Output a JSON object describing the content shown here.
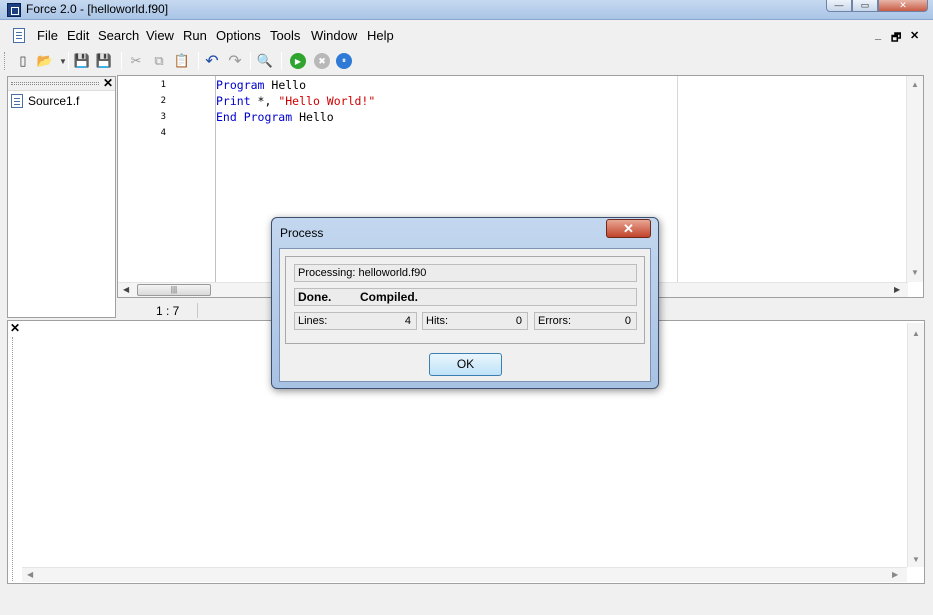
{
  "window": {
    "title": "Force 2.0 - [helloworld.f90]",
    "minimize": "—",
    "maximize": "▭",
    "close": "✕"
  },
  "menu": {
    "items": [
      "File",
      "Edit",
      "Search",
      "View",
      "Run",
      "Options",
      "Tools",
      "Window",
      "Help"
    ]
  },
  "mdi_controls": {
    "minimize": "_",
    "restore": "🗗",
    "close": "✕"
  },
  "toolbar": {
    "buttons": [
      {
        "name": "new-icon",
        "glyph": "▯"
      },
      {
        "name": "open-icon",
        "glyph": "📂"
      },
      {
        "name": "save-icon",
        "glyph": "💾"
      },
      {
        "name": "save-all-icon",
        "glyph": "💾"
      },
      {
        "name": "cut-icon",
        "glyph": "✂"
      },
      {
        "name": "copy-icon",
        "glyph": "⧉"
      },
      {
        "name": "paste-icon",
        "glyph": "📋"
      },
      {
        "name": "undo-icon",
        "glyph": "↶"
      },
      {
        "name": "redo-icon",
        "glyph": "↷"
      },
      {
        "name": "find-icon",
        "glyph": "🔍"
      },
      {
        "name": "run-icon",
        "glyph": "▶"
      },
      {
        "name": "stop-icon",
        "glyph": "✖"
      },
      {
        "name": "pause-icon",
        "glyph": "⏸"
      }
    ]
  },
  "file_panel": {
    "close": "✕",
    "files": [
      "Source1.f"
    ]
  },
  "editor": {
    "line_numbers": [
      "1",
      "2",
      "3",
      "4"
    ],
    "lines": [
      {
        "kw": "Program",
        "rest": " Hello",
        "str": ""
      },
      {
        "kw": "Print",
        "rest": " *, ",
        "str": "\"Hello World!\""
      },
      {
        "kw": "End Program",
        "rest": " Hello",
        "str": ""
      },
      {
        "kw": "",
        "rest": "",
        "str": ""
      }
    ],
    "scroll_thumb": "|||"
  },
  "status": {
    "cursor": "1 :  7"
  },
  "output_panel": {
    "close": "✕"
  },
  "dialog": {
    "title": "Process",
    "close": "✕",
    "processing": "Processing: helloworld.f90",
    "done": "Done.",
    "compiled": "Compiled.",
    "lines_label": "Lines:",
    "lines_value": "4",
    "hits_label": "Hits:",
    "hits_value": "0",
    "errors_label": "Errors:",
    "errors_value": "0",
    "ok": "OK"
  },
  "colors": {
    "keyword": "#0000d0",
    "string": "#d00000",
    "titlebar": "#b6cdeb"
  }
}
